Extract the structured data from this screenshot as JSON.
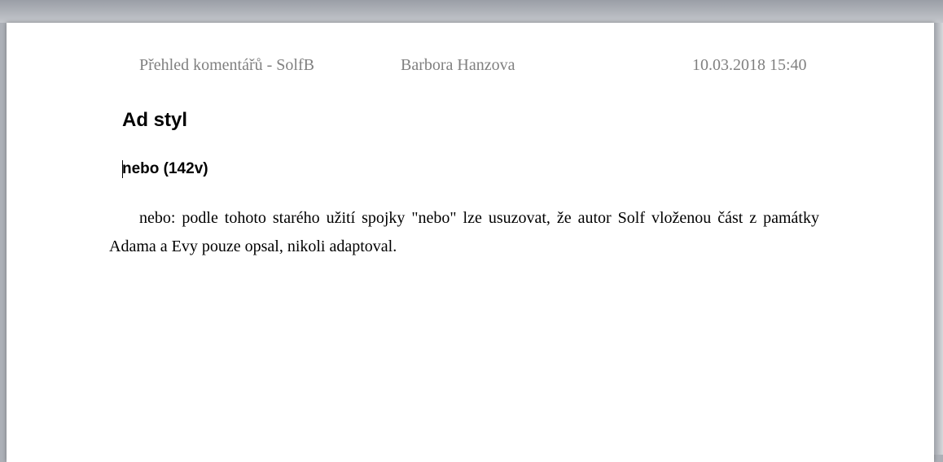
{
  "header": {
    "title": "Přehled komentářů - SolfB",
    "author": "Barbora Hanzova",
    "datetime": "10.03.2018 15:40"
  },
  "document": {
    "heading": "Ad styl",
    "subheading": "nebo (142v)",
    "paragraph": "nebo: podle tohoto starého užití spojky \"nebo\" lze usuzovat, že autor Solf vloženou část z památky Adama a Evy pouze opsal, nikoli adaptoval."
  }
}
